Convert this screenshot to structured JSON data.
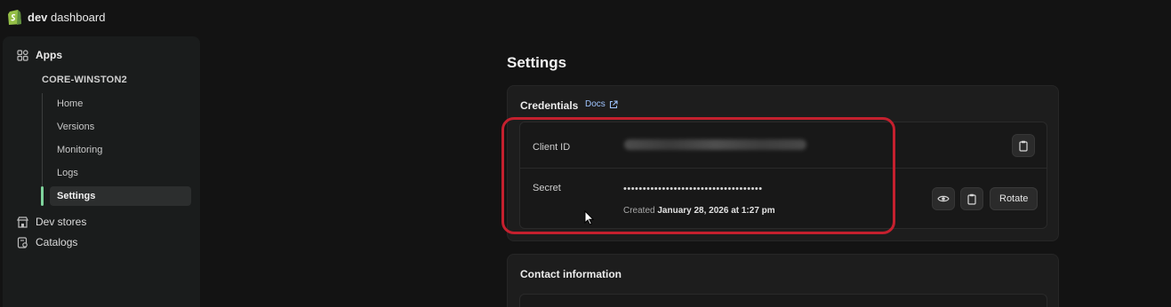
{
  "brand": {
    "bold": "dev",
    "rest": " dashboard"
  },
  "sidebar": {
    "apps_label": "Apps",
    "app_name": "CORE-WINSTON2",
    "items": [
      {
        "label": "Home"
      },
      {
        "label": "Versions"
      },
      {
        "label": "Monitoring"
      },
      {
        "label": "Logs"
      },
      {
        "label": "Settings",
        "active": true
      }
    ],
    "dev_stores_label": "Dev stores",
    "catalogs_label": "Catalogs"
  },
  "main": {
    "title": "Settings",
    "credentials": {
      "title": "Credentials",
      "docs_label": "Docs",
      "client_id_label": "Client ID",
      "secret_label": "Secret",
      "secret_masked": "••••••••••••••••••••••••••••••••••••",
      "created_prefix": "Created ",
      "created_date": "January 28, 2026 at 1:27 pm",
      "rotate_label": "Rotate"
    },
    "contact": {
      "title": "Contact information"
    }
  },
  "colors": {
    "background": "#131313",
    "sidebar": "#1a1c1c",
    "accent_green": "#7fd49c",
    "highlight_red": "#c4202e",
    "link_blue": "#9fc4ff"
  }
}
